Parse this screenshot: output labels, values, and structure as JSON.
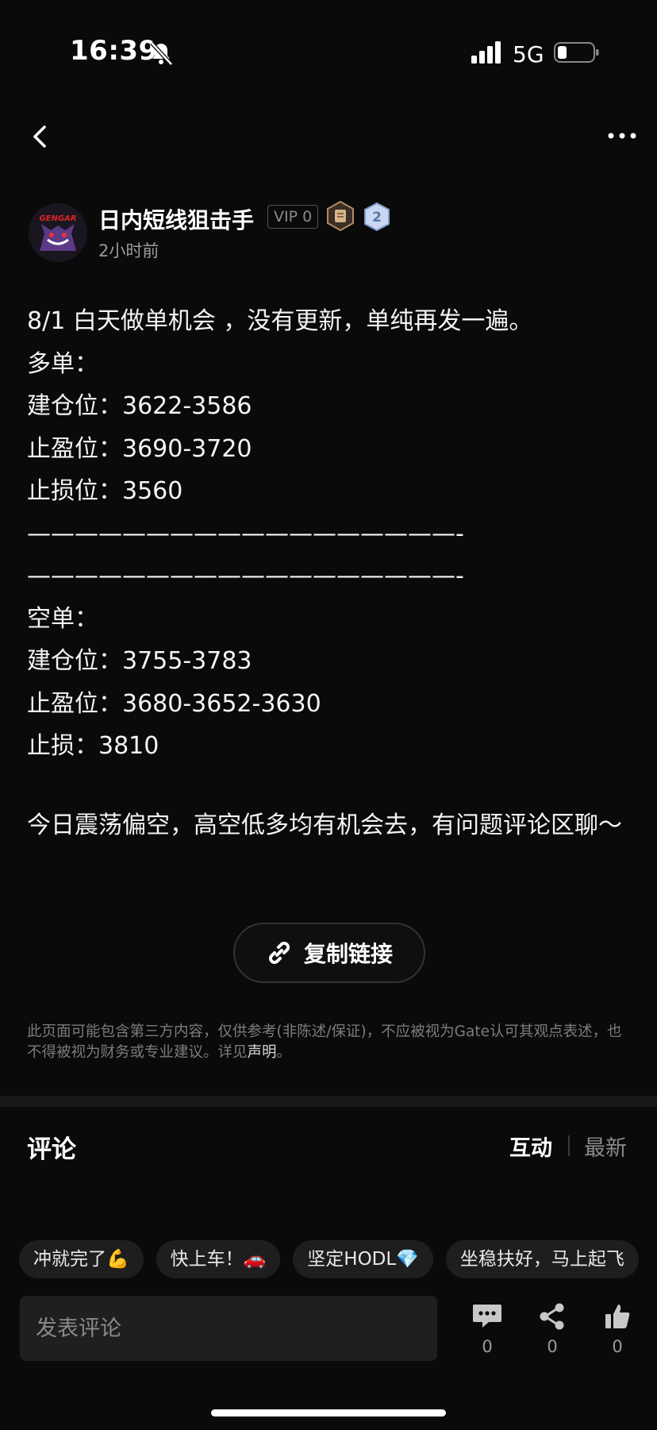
{
  "status_bar": {
    "time": "16:39",
    "network": "5G"
  },
  "author": {
    "name": "日内短线狙击手",
    "vip": "VIP 0",
    "level": "2",
    "post_time": "2小时前",
    "avatar_text": "GENGAR"
  },
  "post": {
    "lines": [
      "8/1  白天做单机会 ，没有更新，单纯再发一遍。",
      "多单：",
      "建仓位：3622-3586",
      "止盈位：3690-3720",
      "止损位：3560",
      "——————————————————-",
      "——————————————————-",
      "空单：",
      "建仓位：3755-3783",
      "止盈位：3680-3652-3630",
      "止损：3810"
    ],
    "closing": "今日震荡偏空，高空低多均有机会去，有问题评论区聊～"
  },
  "copy_link_label": "复制链接",
  "disclaimer": {
    "text": "此页面可能包含第三方内容，仅供参考(非陈述/保证)，不应被视为Gate认可其观点表述，也不得被视为财务或专业建议。详见",
    "link": "声明",
    "end": "。"
  },
  "comments": {
    "title": "评论",
    "tab_active": "互动",
    "tab_inactive": "最新"
  },
  "chips": [
    "冲就完了💪",
    "快上车！🚗",
    "坚定HODL💎",
    "坐稳扶好，马上起飞"
  ],
  "comment_input": {
    "placeholder": "发表评论"
  },
  "actions": {
    "comments_count": "0",
    "shares_count": "0",
    "likes_count": "0"
  },
  "colors": {
    "background": "#0a0a0a",
    "text": "#f2f2f2",
    "muted": "#8a8a8a",
    "chip_bg": "#1e1e1e"
  }
}
